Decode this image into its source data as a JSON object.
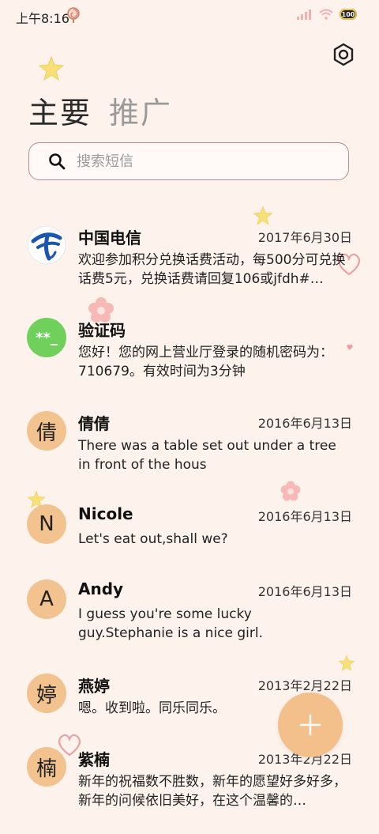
{
  "status_bar": {
    "time": "上午8:16",
    "battery_level": "100",
    "icons": [
      "lollipop-icon",
      "signal-icon",
      "wifi-icon",
      "battery-icon"
    ]
  },
  "tabs": [
    {
      "label": "主要",
      "active": true
    },
    {
      "label": "推广",
      "active": false
    }
  ],
  "search": {
    "placeholder": "搜索短信",
    "value": ""
  },
  "conversations": [
    {
      "name": "中国电信",
      "date": "2017年6月30日",
      "preview": "欢迎参加积分兑换话费活动，每500分可兑换话费5元，兑换话费请回复106或jfdh#…",
      "avatar_type": "logo",
      "avatar_text": ""
    },
    {
      "name": "验证码",
      "date": "",
      "preview": "您好！您的网上营业厅登录的随机密码为：710679。有效时间为3分钟",
      "avatar_type": "code",
      "avatar_text": "**_"
    },
    {
      "name": "倩倩",
      "date": "2016年6月13日",
      "preview": "There was a table set out under a tree in front of the hous",
      "avatar_type": "letter",
      "avatar_text": "倩"
    },
    {
      "name": "Nicole",
      "date": "2016年6月13日",
      "preview": "Let's eat out,shall we?",
      "avatar_type": "letter",
      "avatar_text": "N"
    },
    {
      "name": "Andy",
      "date": "2016年6月13日",
      "preview": "I guess you're some lucky guy.Stephanie is a nice girl.",
      "avatar_type": "letter",
      "avatar_text": "A"
    },
    {
      "name": "燕婷",
      "date": "2013年2月22日",
      "preview": "嗯。收到啦。同乐同乐。",
      "avatar_type": "letter",
      "avatar_text": "婷"
    },
    {
      "name": "紫楠",
      "date": "2013年2月22日",
      "preview": "新年的祝福数不胜数，新年的愿望好多好多，新年的问候依旧美好，在这个温馨的…",
      "avatar_type": "letter",
      "avatar_text": "楠"
    }
  ],
  "colors": {
    "background": "#fdf3ec",
    "avatar_letter_bg": "#f2c38f",
    "code_avatar_bg": "#6fd15b",
    "fab_bg": "#f3bf8b",
    "search_border": "#b78b91",
    "telecom_blue": "#1a56b0"
  }
}
